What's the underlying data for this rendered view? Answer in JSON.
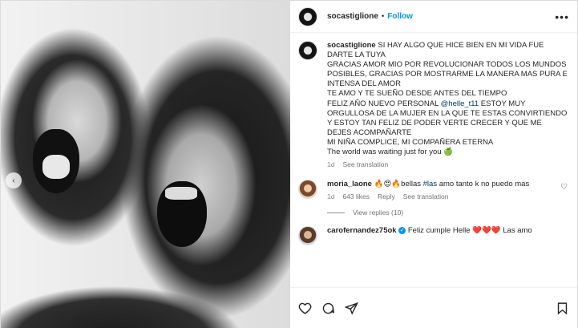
{
  "header": {
    "username": "socastiglione",
    "dot": "•",
    "follow_label": "Follow",
    "more_label": "•••"
  },
  "caption": {
    "username": "socastiglione",
    "text_1": "SI HAY ALGO QUE HICE BIEN EN MI VIDA FUE DARTE LA TUYA",
    "text_2": "GRACIAS AMOR MIO POR REVOLUCIONAR TODOS LOS MUNDOS POSIBLES, GRACIAS POR MOSTRARME LA MANERA MAS PURA E INTENSA DEL AMOR",
    "text_3": "TE AMO Y TE SUEÑO DESDE ANTES DEL TIEMPO",
    "text_4_pre": "FELIZ AÑO NUEVO PERSONAL ",
    "mention": "@helle_t11",
    "text_4_post": " ESTOY MUY ORGULLOSA DE LA MUJER EN LA QUE TE ESTAS CONVIRTIENDO Y ESTOY TAN FELIZ DE PODER VERTE CRECER Y QUE ME DEJES ACOMPAÑARTE",
    "text_5": "MI NIÑA COMPLICE, MI COMPAÑERA ETERNA",
    "text_6": "The world was waiting just for you 🍏",
    "age": "1d",
    "see_translation": "See translation"
  },
  "comment1": {
    "username": "moria_laone",
    "emojis": "🔥😍🔥",
    "text_a": "bellas ",
    "hashtag": "#las",
    "text_b": " amo tanto k no puedo mas",
    "age": "1d",
    "likes": "643 likes",
    "reply": "Reply",
    "see_translation": "See translation",
    "view_replies": "View replies (10)"
  },
  "comment2": {
    "username": "carofernandez75ok",
    "text": "Feliz cumple Helle ❤️❤️❤️ Las amo"
  },
  "icons": {
    "prev": "chevron-left-icon",
    "heart": "heart-icon",
    "comment": "comment-icon",
    "share": "share-icon",
    "save": "bookmark-icon"
  },
  "colors": {
    "accent": "#0095f6",
    "link": "#00376b",
    "muted": "#737373"
  }
}
